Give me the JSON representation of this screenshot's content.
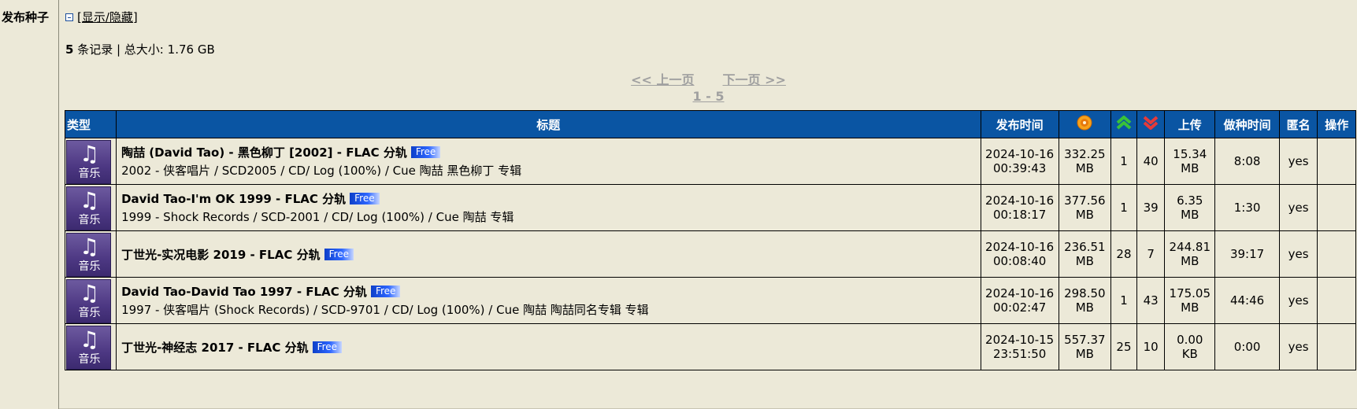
{
  "section": {
    "label": "发布种子",
    "toggle_text": "[显示/隐藏]"
  },
  "summary": {
    "count": "5",
    "count_suffix": "条记录 | 总大小:",
    "total_size": "1.76 GB"
  },
  "pager": {
    "prev": "<< 上一页",
    "next": "下一页 >>",
    "range": "1 - 5"
  },
  "table": {
    "headers": {
      "type": "类型",
      "title": "标题",
      "time": "发布时间",
      "size_icon": "disc-icon",
      "seeders_icon": "up-arrows-icon",
      "leechers_icon": "down-arrows-icon",
      "upload": "上传",
      "seed_time": "做种时间",
      "anonymous": "匿名",
      "actions": "操作"
    },
    "rows": [
      {
        "category": "音乐",
        "title": "陶喆 (David Tao) - 黑色柳丁 [2002] - FLAC 分轨",
        "badge": "Free",
        "desc": "2002 - 侠客唱片 / SCD2005 / CD/ Log (100%) / Cue 陶喆 黑色柳丁 专辑",
        "date": "2024-10-16",
        "time": "00:39:43",
        "size_num": "332.25",
        "size_unit": "MB",
        "seeders": "1",
        "leechers": "40",
        "up_num": "15.34",
        "up_unit": "MB",
        "seed_time": "8:08",
        "anonymous": "yes"
      },
      {
        "category": "音乐",
        "title": "David Tao-I'm OK 1999 - FLAC 分轨",
        "badge": "Free",
        "desc": "1999 - Shock Records / SCD-2001 / CD/ Log (100%) / Cue 陶喆 专辑",
        "date": "2024-10-16",
        "time": "00:18:17",
        "size_num": "377.56",
        "size_unit": "MB",
        "seeders": "1",
        "leechers": "39",
        "up_num": "6.35",
        "up_unit": "MB",
        "seed_time": "1:30",
        "anonymous": "yes"
      },
      {
        "category": "音乐",
        "title": "丁世光-实况电影 2019 - FLAC 分轨",
        "badge": "Free",
        "desc": "",
        "date": "2024-10-16",
        "time": "00:08:40",
        "size_num": "236.51",
        "size_unit": "MB",
        "seeders": "28",
        "leechers": "7",
        "up_num": "244.81",
        "up_unit": "MB",
        "seed_time": "39:17",
        "anonymous": "yes"
      },
      {
        "category": "音乐",
        "title": "David Tao-David Tao 1997 - FLAC 分轨",
        "badge": "Free",
        "desc": "1997 - 侠客唱片 (Shock Records) / SCD-9701 / CD/ Log (100%) / Cue 陶喆 陶喆同名专辑 专辑",
        "date": "2024-10-16",
        "time": "00:02:47",
        "size_num": "298.50",
        "size_unit": "MB",
        "seeders": "1",
        "leechers": "43",
        "up_num": "175.05",
        "up_unit": "MB",
        "seed_time": "44:46",
        "anonymous": "yes"
      },
      {
        "category": "音乐",
        "title": "丁世光-神经志 2017 - FLAC 分轨",
        "badge": "Free",
        "desc": "",
        "date": "2024-10-15",
        "time": "23:51:50",
        "size_num": "557.37",
        "size_unit": "MB",
        "seeders": "25",
        "leechers": "10",
        "up_num": "0.00",
        "up_unit": "KB",
        "seed_time": "0:00",
        "anonymous": "yes"
      }
    ]
  }
}
